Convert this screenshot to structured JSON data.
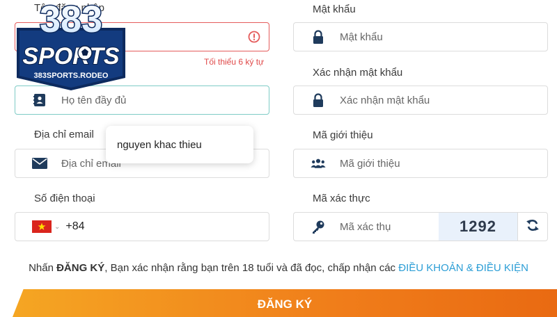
{
  "logo": {
    "big_text": "383",
    "sports_text": "SPORTS",
    "domain_text": "383SPORTS.RODEO"
  },
  "form": {
    "username": {
      "label": "Tên đăng nhập",
      "placeholder": "",
      "error": "Tối thiểu 6 ký tự"
    },
    "password": {
      "label": "Mật khẩu",
      "placeholder": "Mật khẩu"
    },
    "fullname": {
      "placeholder": "Họ tên đầy đủ"
    },
    "confirm_password": {
      "label": "Xác nhận mật khẩu",
      "placeholder": "Xác nhận mật khẩu"
    },
    "email": {
      "label": "Địa chỉ email",
      "placeholder": "Địa chỉ email"
    },
    "referral": {
      "label": "Mã giới thiệu",
      "placeholder": "Mã giới thiệu"
    },
    "phone": {
      "label": "Số điện thoại",
      "country_code": "+84"
    },
    "captcha": {
      "label": "Mã xác thực",
      "placeholder": "Mã xác thụ",
      "code": "1292"
    },
    "autocomplete_suggestion": "nguyen khac thieu"
  },
  "terms": {
    "prefix": "Nhấn ",
    "bold": "ĐĂNG KÝ",
    "middle": ", Bạn xác nhận rằng bạn trên 18 tuổi và đã đọc, chấp nhận các ",
    "link": "ĐIỀU KHOẢN & ĐIỀU KIỆN"
  },
  "submit_label": "ĐĂNG KÝ",
  "colors": {
    "error": "#e45b5b",
    "focus": "#7ecbc6",
    "link": "#2c9ed6",
    "button_start": "#f5a623",
    "button_end": "#e96a12",
    "icon": "#1f3b5c"
  }
}
